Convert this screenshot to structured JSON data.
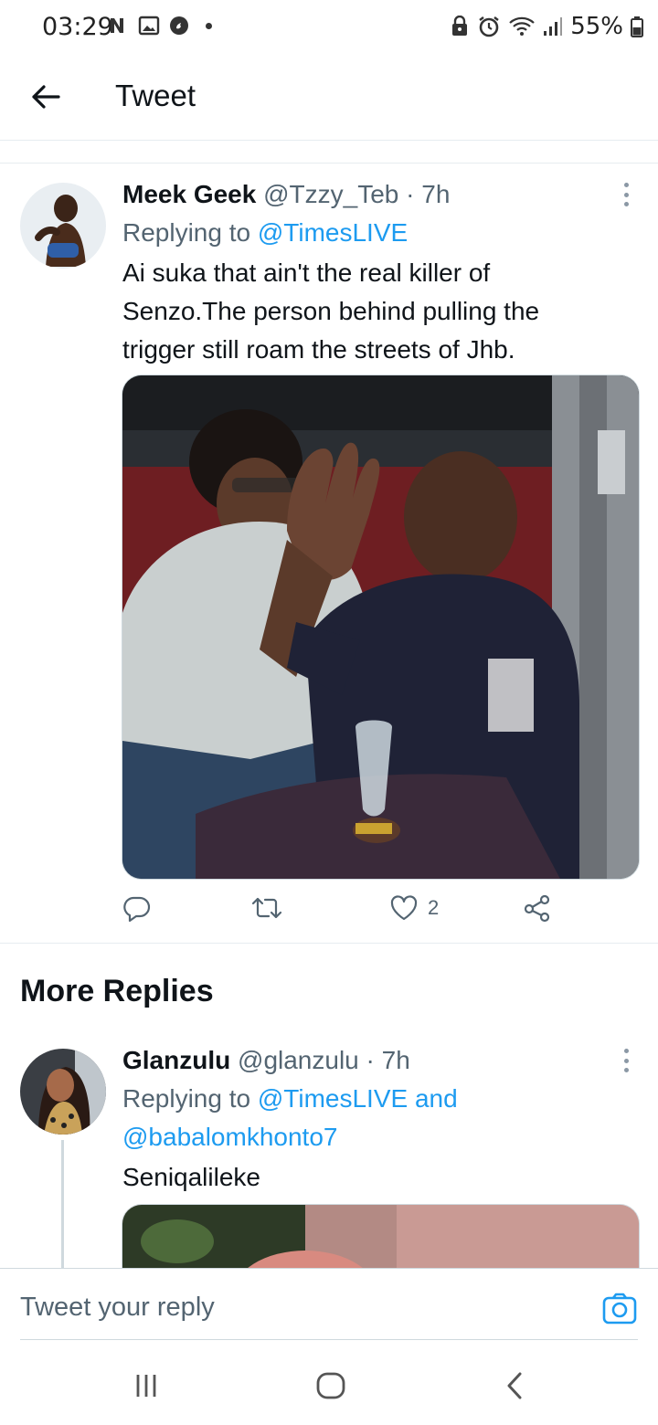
{
  "status_bar": {
    "time": "03:29",
    "battery": "55%"
  },
  "header": {
    "title": "Tweet"
  },
  "tweet": {
    "name": "Meek Geek",
    "handle": "@Tzzy_Teb",
    "time": " · 7h",
    "replying_prefix": "Replying to ",
    "replying_to": "@TimesLIVE",
    "text_line1": "Ai suka that ain't the real killer of",
    "text_line2": "Senzo.The person behind pulling the",
    "text_line3": "trigger still roam the  streets of Jhb.",
    "likes": "2"
  },
  "section": {
    "more_replies": "More Replies"
  },
  "reply": {
    "name": "Glanzulu",
    "handle": "@glanzulu",
    "time": " · 7h",
    "replying_prefix": "Replying to ",
    "replying_to": "@TimesLIVE and",
    "replying_to2": "@babalomkhonto7",
    "text": "Seniqalileke"
  },
  "composer": {
    "placeholder": "Tweet your reply"
  },
  "colors": {
    "link": "#1d9bf0",
    "secondary_text": "#536471"
  }
}
